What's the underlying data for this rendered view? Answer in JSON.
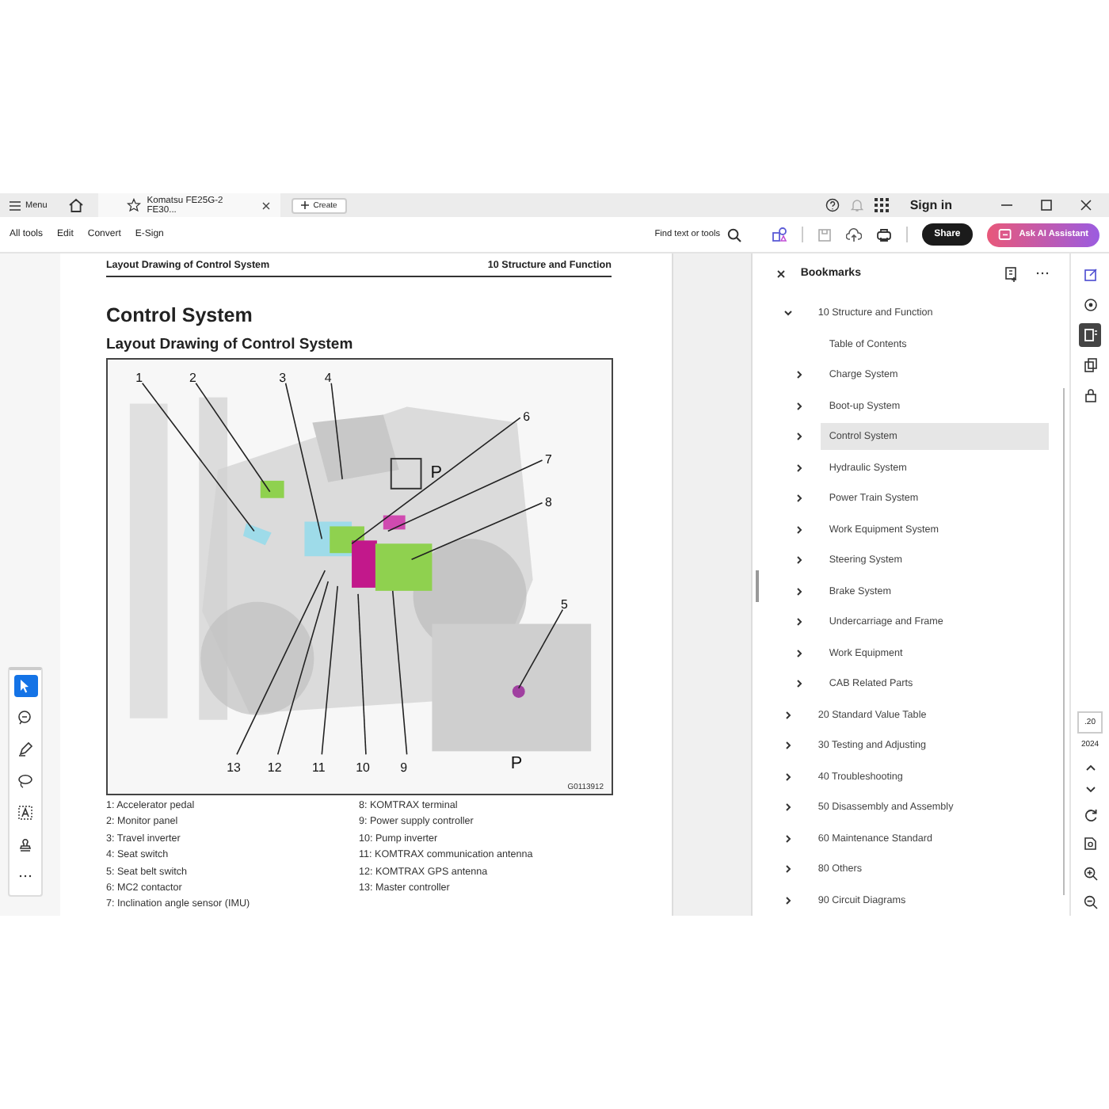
{
  "title_bar": {
    "menu_label": "Menu",
    "tab": {
      "title": "Komatsu FE25G-2 FE30...",
      "selected": true
    },
    "create_label": "Create",
    "sign_in": "Sign in"
  },
  "toolbar": {
    "items": [
      "All tools",
      "Edit",
      "Convert",
      "E-Sign"
    ],
    "find": "Find text or tools",
    "share": "Share",
    "ai_assistant": "Ask AI Assistant"
  },
  "tools": [
    {
      "kind": "select",
      "selected": true
    },
    {
      "kind": "comment",
      "selected": false
    },
    {
      "kind": "pen",
      "selected": false
    },
    {
      "kind": "lasso",
      "selected": false
    },
    {
      "kind": "text",
      "selected": false
    },
    {
      "kind": "stamp",
      "selected": false
    },
    {
      "kind": "more",
      "selected": false
    }
  ],
  "page": {
    "header_left": "Layout Drawing of Control System",
    "header_right": "10 Structure and Function",
    "title": "Control System",
    "subtitle": "Layout Drawing of Control System",
    "figure": {
      "callouts": [
        "1",
        "2",
        "3",
        "4",
        "6",
        "7",
        "8",
        "5",
        "13",
        "12",
        "11",
        "10",
        "9"
      ],
      "marker_label": "P",
      "inset_label": "P",
      "code": "G0113912"
    },
    "legend": [
      [
        "1: Accelerator pedal",
        "2: Monitor panel",
        "3: Travel inverter",
        "4: Seat switch",
        "5: Seat belt switch",
        "6: MC2 contactor",
        "7: Inclination angle sensor (IMU)"
      ],
      [
        "8: KOMTRAX terminal",
        "9: Power supply controller",
        "10: Pump inverter",
        "11: KOMTRAX communication antenna",
        "12: KOMTRAX GPS antenna",
        "13: Master controller"
      ]
    ]
  },
  "bookmarks": {
    "title": "Bookmarks",
    "items": [
      {
        "label": "10 Structure and Function",
        "kind": "folder",
        "expanded": true,
        "selected": false,
        "children": [
          {
            "label": "Table of Contents",
            "kind": "leaf",
            "selected": false
          },
          {
            "label": "Charge System",
            "kind": "folder",
            "expanded": false,
            "selected": false
          },
          {
            "label": "Boot-up System",
            "kind": "folder",
            "expanded": false,
            "selected": false
          },
          {
            "label": "Control System",
            "kind": "folder",
            "expanded": false,
            "selected": true
          },
          {
            "label": "Hydraulic System",
            "kind": "folder",
            "expanded": false,
            "selected": false
          },
          {
            "label": "Power Train System",
            "kind": "folder",
            "expanded": false,
            "selected": false
          },
          {
            "label": "Work Equipment System",
            "kind": "folder",
            "expanded": false,
            "selected": false
          },
          {
            "label": "Steering System",
            "kind": "folder",
            "expanded": false,
            "selected": false
          },
          {
            "label": "Brake System",
            "kind": "folder",
            "expanded": false,
            "selected": false
          },
          {
            "label": "Undercarriage and Frame",
            "kind": "folder",
            "expanded": false,
            "selected": false
          },
          {
            "label": "Work Equipment",
            "kind": "folder",
            "expanded": false,
            "selected": false
          },
          {
            "label": "CAB Related Parts",
            "kind": "folder",
            "expanded": false,
            "selected": false
          }
        ]
      },
      {
        "label": "20 Standard Value Table",
        "kind": "folder",
        "expanded": false,
        "selected": false
      },
      {
        "label": "30 Testing and Adjusting",
        "kind": "folder",
        "expanded": false,
        "selected": false
      },
      {
        "label": "40 Troubleshooting",
        "kind": "folder",
        "expanded": false,
        "selected": false
      },
      {
        "label": "50 Disassembly and Assembly",
        "kind": "folder",
        "expanded": false,
        "selected": false
      },
      {
        "label": "60 Maintenance Standard",
        "kind": "folder",
        "expanded": false,
        "selected": false
      },
      {
        "label": "80 Others",
        "kind": "folder",
        "expanded": false,
        "selected": false
      },
      {
        "label": "90 Circuit Diagrams",
        "kind": "folder",
        "expanded": false,
        "selected": false
      }
    ]
  },
  "rail": {
    "panels": [
      {
        "kind": "edit",
        "selected": false
      },
      {
        "kind": "comments",
        "selected": false
      },
      {
        "kind": "bookmarks",
        "selected": true
      },
      {
        "kind": "pages",
        "selected": false
      },
      {
        "kind": "protect",
        "selected": false
      }
    ],
    "page_number": ".20",
    "page_count": "2024"
  }
}
